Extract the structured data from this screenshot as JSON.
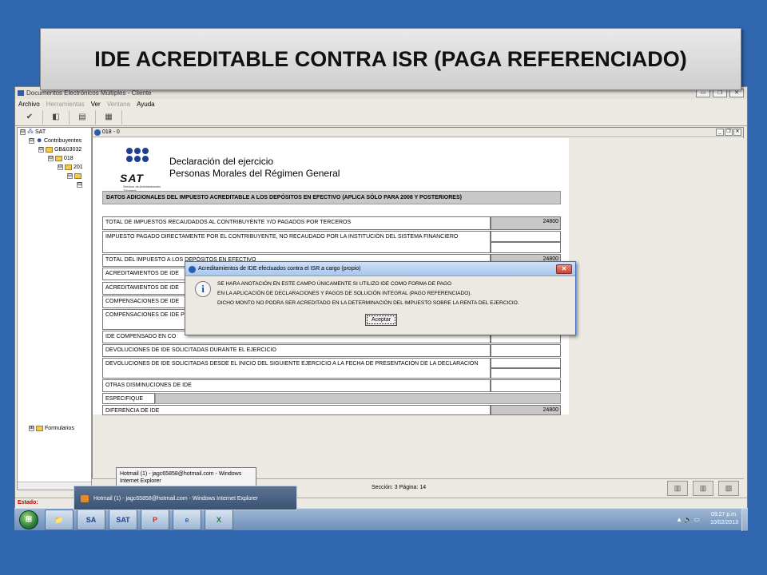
{
  "slide": {
    "title": "IDE ACREDITABLE CONTRA ISR (PAGA REFERENCIADO)"
  },
  "app": {
    "title": "Documentos Electrónicos Múltiples - Cliente",
    "menu": {
      "archivo": "Archivo",
      "herramientas": "Herramientas",
      "ver": "Ver",
      "ventana": "Ventana",
      "ayuda": "Ayuda"
    },
    "toolbar": {
      "check": "✔",
      "erase": "◧",
      "list": "▤",
      "print": "▦"
    },
    "window_controls": {
      "minimize": "▭",
      "restore": "❐",
      "close": "✕"
    }
  },
  "tree": {
    "items": [
      {
        "expander": "⊟",
        "label": "SAT"
      },
      {
        "expander": "⊟",
        "label": "Contribuyentes"
      },
      {
        "expander": "⊟",
        "label": "GB&03032"
      },
      {
        "expander": "⊟",
        "label": "018"
      },
      {
        "expander": "⊟",
        "label": "201"
      },
      {
        "expander": "⊟",
        "label": ""
      },
      {
        "expander": "⊟",
        "label": ""
      }
    ],
    "formularios": {
      "expander": "⊞",
      "label": "Formularios"
    }
  },
  "doc_window": {
    "title": "018 - 0",
    "controls": {
      "minimize": "_",
      "restore": "❐",
      "close": "✕"
    }
  },
  "document": {
    "logo": {
      "word": "SAT",
      "subtitle": "Servicio de Administración Tributaria"
    },
    "heading1": "Declaración del ejercicio",
    "heading2": "Personas Morales del Régimen General",
    "section": "DATOS ADICIONALES DEL IMPUESTO ACREDITABLE A LOS DEPÓSITOS EN EFECTIVO (APLICA SÓLO PARA 2008 Y POSTERIORES)",
    "rows": [
      {
        "label": "TOTAL DE IMPUESTOS RECAUDADOS AL CONTRIBUYENTE Y/O PAGADOS POR TERCEROS",
        "value": "24800"
      },
      {
        "label": "IMPUESTO PAGADO DIRECTAMENTE POR EL CONTRIBUYENTE, NO RECAUDADO POR LA INSTITUCIÓN DEL SISTEMA FINANCIERO",
        "value": ""
      },
      {
        "label": "TOTAL DEL IMPUESTO A LOS DEPÓSITOS EN EFECTIVO",
        "value": "24800"
      },
      {
        "label": "ACREDITAMIENTOS DE IDE",
        "value": ""
      },
      {
        "label": "ACREDITAMIENTOS DE IDE",
        "value": ""
      },
      {
        "label": "COMPENSACIONES DE IDE",
        "value": ""
      },
      {
        "label": "COMPENSACIONES DE IDE PRESENTACIÓN DE LA DE",
        "value": ""
      },
      {
        "label": "IDE COMPENSADO EN CO",
        "value": ""
      },
      {
        "label": "DEVOLUCIONES DE IDE SOLICITADAS DURANTE EL EJERCICIO",
        "value": ""
      },
      {
        "label": "DEVOLUCIONES DE IDE SOLICITADAS DESDE EL INICIO DEL SIGUIENTE EJERCICIO A LA FECHA DE PRESENTACIÓN DE LA DECLARACIÓN",
        "value": ""
      },
      {
        "label": "OTRAS DISMINUCIONES DE IDE",
        "value": ""
      },
      {
        "label": "ESPECIFIQUE",
        "value": ""
      },
      {
        "label": "DIFERENCIA DE IDE",
        "value": "24800"
      }
    ]
  },
  "dialog": {
    "title": "Acreditamientos de IDE efectuados contra el ISR a cargo (propio)",
    "close": "✕",
    "info_icon": "i",
    "line1": "SE HARA ANOTACIÓN EN ESTE CAMPO ÚNICAMENTE SI UTILIZO IDE COMO FORMA DE PAGO",
    "line2": "EN LA APLICACIÓN DE DECLARACIONES Y PAGOS DE SOLUCIÓN INTEGRAL (PAGO REFERENCIADO).",
    "line3": "DICHO MONTO NO PODRA SER ACREDITADO EN LA DETERMINACIÓN DEL IMPUESTO SOBRE LA RENTA DEL EJERCICIO.",
    "ok": "Aceptar"
  },
  "pagebar": {
    "page_info": "Sección: 3  Página: 14"
  },
  "status": {
    "label": "Estado:"
  },
  "tooltip": {
    "line1": "Hotmail (1) - jagc65858@hotmail.com - Windows",
    "line2": "Internet Explorer"
  },
  "popup": {
    "label": "Hotmail (1) - jagc65858@hotmail.com - Windows Internet Explorer"
  },
  "taskbar": {
    "start": "⊞",
    "buttons": [
      "📁",
      "SA",
      "SAT",
      "P",
      "e",
      "X"
    ],
    "tray": "▲ 🔈 ▭",
    "time": "09:27 p.m.",
    "date": "10/02/2013"
  },
  "colors": {
    "background": "#2f66ad",
    "section_gray": "#c8c8c8",
    "status_red": "#c00000"
  }
}
